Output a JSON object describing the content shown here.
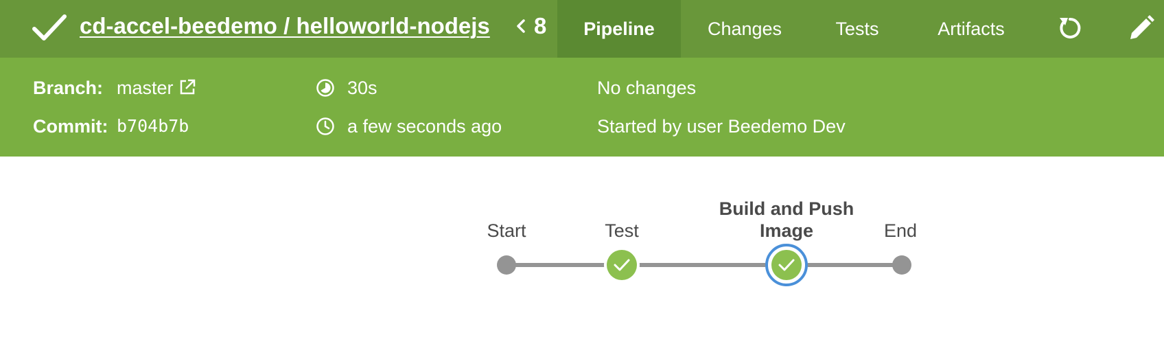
{
  "header": {
    "title": "cd-accel-beedemo / helloworld-nodejs",
    "run_number": "8",
    "tabs": [
      {
        "label": "Pipeline",
        "active": true
      },
      {
        "label": "Changes",
        "active": false
      },
      {
        "label": "Tests",
        "active": false
      },
      {
        "label": "Artifacts",
        "active": false
      }
    ],
    "icons": [
      "check-icon",
      "chevron-left-icon",
      "rerun-icon",
      "pencil-icon"
    ]
  },
  "info": {
    "branch_label": "Branch:",
    "branch_value": "master",
    "commit_label": "Commit:",
    "commit_value": "b704b7b",
    "duration": "30s",
    "started_time": "a few seconds ago",
    "changes": "No changes",
    "started_by": "Started by user Beedemo Dev"
  },
  "pipeline": {
    "stages": [
      {
        "label": "Start",
        "status": "none"
      },
      {
        "label": "Test",
        "status": "success"
      },
      {
        "label_line1": "Build and Push",
        "label_line2": "Image",
        "status": "success",
        "selected": true
      },
      {
        "label": "End",
        "status": "none"
      }
    ]
  },
  "colors": {
    "header_bg": "#69973a",
    "info_bg": "#7aaf41",
    "success": "#8cc04f",
    "selected_ring": "#4a90d9",
    "node_gray": "#949494"
  }
}
